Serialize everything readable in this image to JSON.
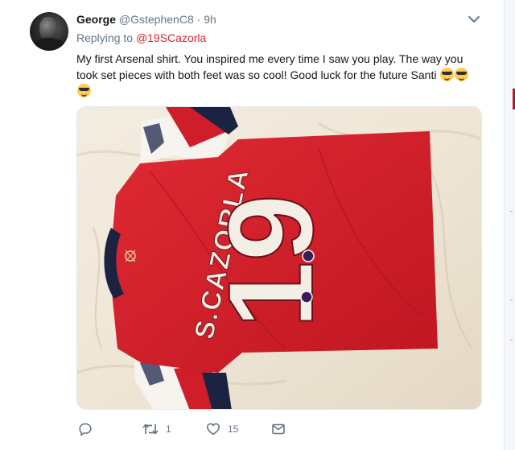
{
  "tweet": {
    "author_name": "George",
    "author_handle": "@GstephenC8",
    "separator": "·",
    "time": "9h",
    "replying_to_label": "Replying to",
    "replying_to_handle": "@19SCazorla",
    "text": "My first Arsenal shirt. You inspired me every time I saw you play. The way you took set pieces with both feet was so cool! Good luck for the future Santi",
    "emoji_names": [
      "smiling-face-with-sunglasses",
      "smiling-face-with-sunglasses",
      "smiling-face-with-sunglasses"
    ],
    "media": {
      "shirt_name": "S.CAZORLA",
      "shirt_number": "19"
    },
    "actions": {
      "reply_icon": "reply-icon",
      "retweet_icon": "retweet-icon",
      "retweet_count": "1",
      "like_icon": "heart-icon",
      "like_count": "15",
      "dm_icon": "envelope-icon"
    }
  },
  "colors": {
    "mention": "#e0245e",
    "muted": "#657786",
    "shirt_red": "#d0202c"
  }
}
